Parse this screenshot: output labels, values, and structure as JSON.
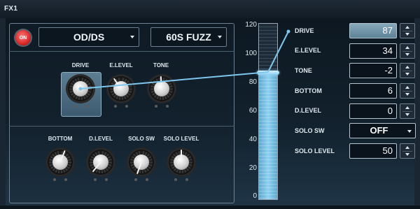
{
  "header": {
    "title": "FX1"
  },
  "effect": {
    "on_label": "ON",
    "type_value": "OD/DS",
    "variation_value": "60S FUZZ"
  },
  "knobs_top": [
    {
      "label": "DRIVE"
    },
    {
      "label": "E.LEVEL"
    },
    {
      "label": "TONE"
    }
  ],
  "knobs_bottom": [
    {
      "label": "BOTTOM"
    },
    {
      "label": "D.LEVEL"
    },
    {
      "label": "SOLO SW"
    },
    {
      "label": "SOLO LEVEL"
    }
  ],
  "slider": {
    "ticks": [
      "120",
      "100",
      "80",
      "60",
      "40",
      "20",
      "0"
    ],
    "value": 87,
    "min": 0,
    "max": 120
  },
  "params": [
    {
      "label": "DRIVE",
      "value": "87"
    },
    {
      "label": "E.LEVEL",
      "value": "34"
    },
    {
      "label": "TONE",
      "value": "-2"
    },
    {
      "label": "BOTTOM",
      "value": "6"
    },
    {
      "label": "D.LEVEL",
      "value": "0"
    },
    {
      "label": "SOLO SW",
      "value": "OFF"
    },
    {
      "label": "SOLO LEVEL",
      "value": "50"
    }
  ],
  "colors": {
    "accent": "#7ec6ee",
    "on_button": "#d21d1d"
  }
}
